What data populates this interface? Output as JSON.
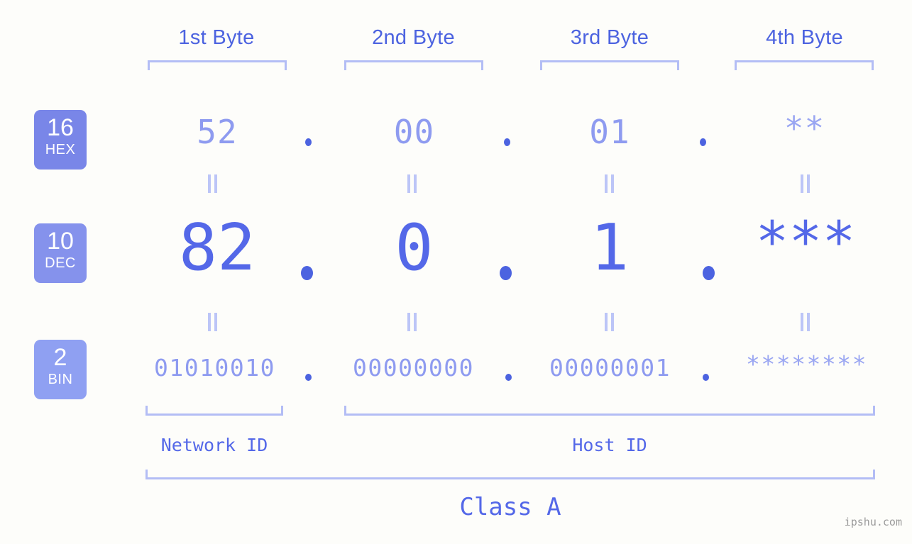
{
  "meta": {
    "background_color": "#fdfdfa",
    "accent_dark": "#4c63e0",
    "accent_mid": "#5468e8",
    "accent_light": "#8e9bf0",
    "bracket_color": "#b3bdf5",
    "watermark": "ipshu.com"
  },
  "byte_headers": [
    {
      "label": "1st Byte"
    },
    {
      "label": "2nd Byte"
    },
    {
      "label": "3rd Byte"
    },
    {
      "label": "4th Byte"
    }
  ],
  "bases": [
    {
      "number": "16",
      "abbr": "HEX",
      "color": "#7986e8"
    },
    {
      "number": "10",
      "abbr": "DEC",
      "color": "#8592ec"
    },
    {
      "number": "2",
      "abbr": "BIN",
      "color": "#8fa0f2"
    }
  ],
  "rows": {
    "hex": {
      "base_number": "16",
      "base_abbr": "HEX",
      "values": [
        "52",
        "00",
        "01",
        "**"
      ],
      "separator": "."
    },
    "dec": {
      "base_number": "10",
      "base_abbr": "DEC",
      "values": [
        "82",
        "0",
        "1",
        "***"
      ],
      "separator": "."
    },
    "bin": {
      "base_number": "2",
      "base_abbr": "BIN",
      "values": [
        "01010010",
        "00000000",
        "00000001",
        "********"
      ],
      "separator": "."
    }
  },
  "equality_symbol": "=",
  "segments": {
    "network_id": "Network ID",
    "host_id": "Host ID",
    "class": "Class A"
  }
}
